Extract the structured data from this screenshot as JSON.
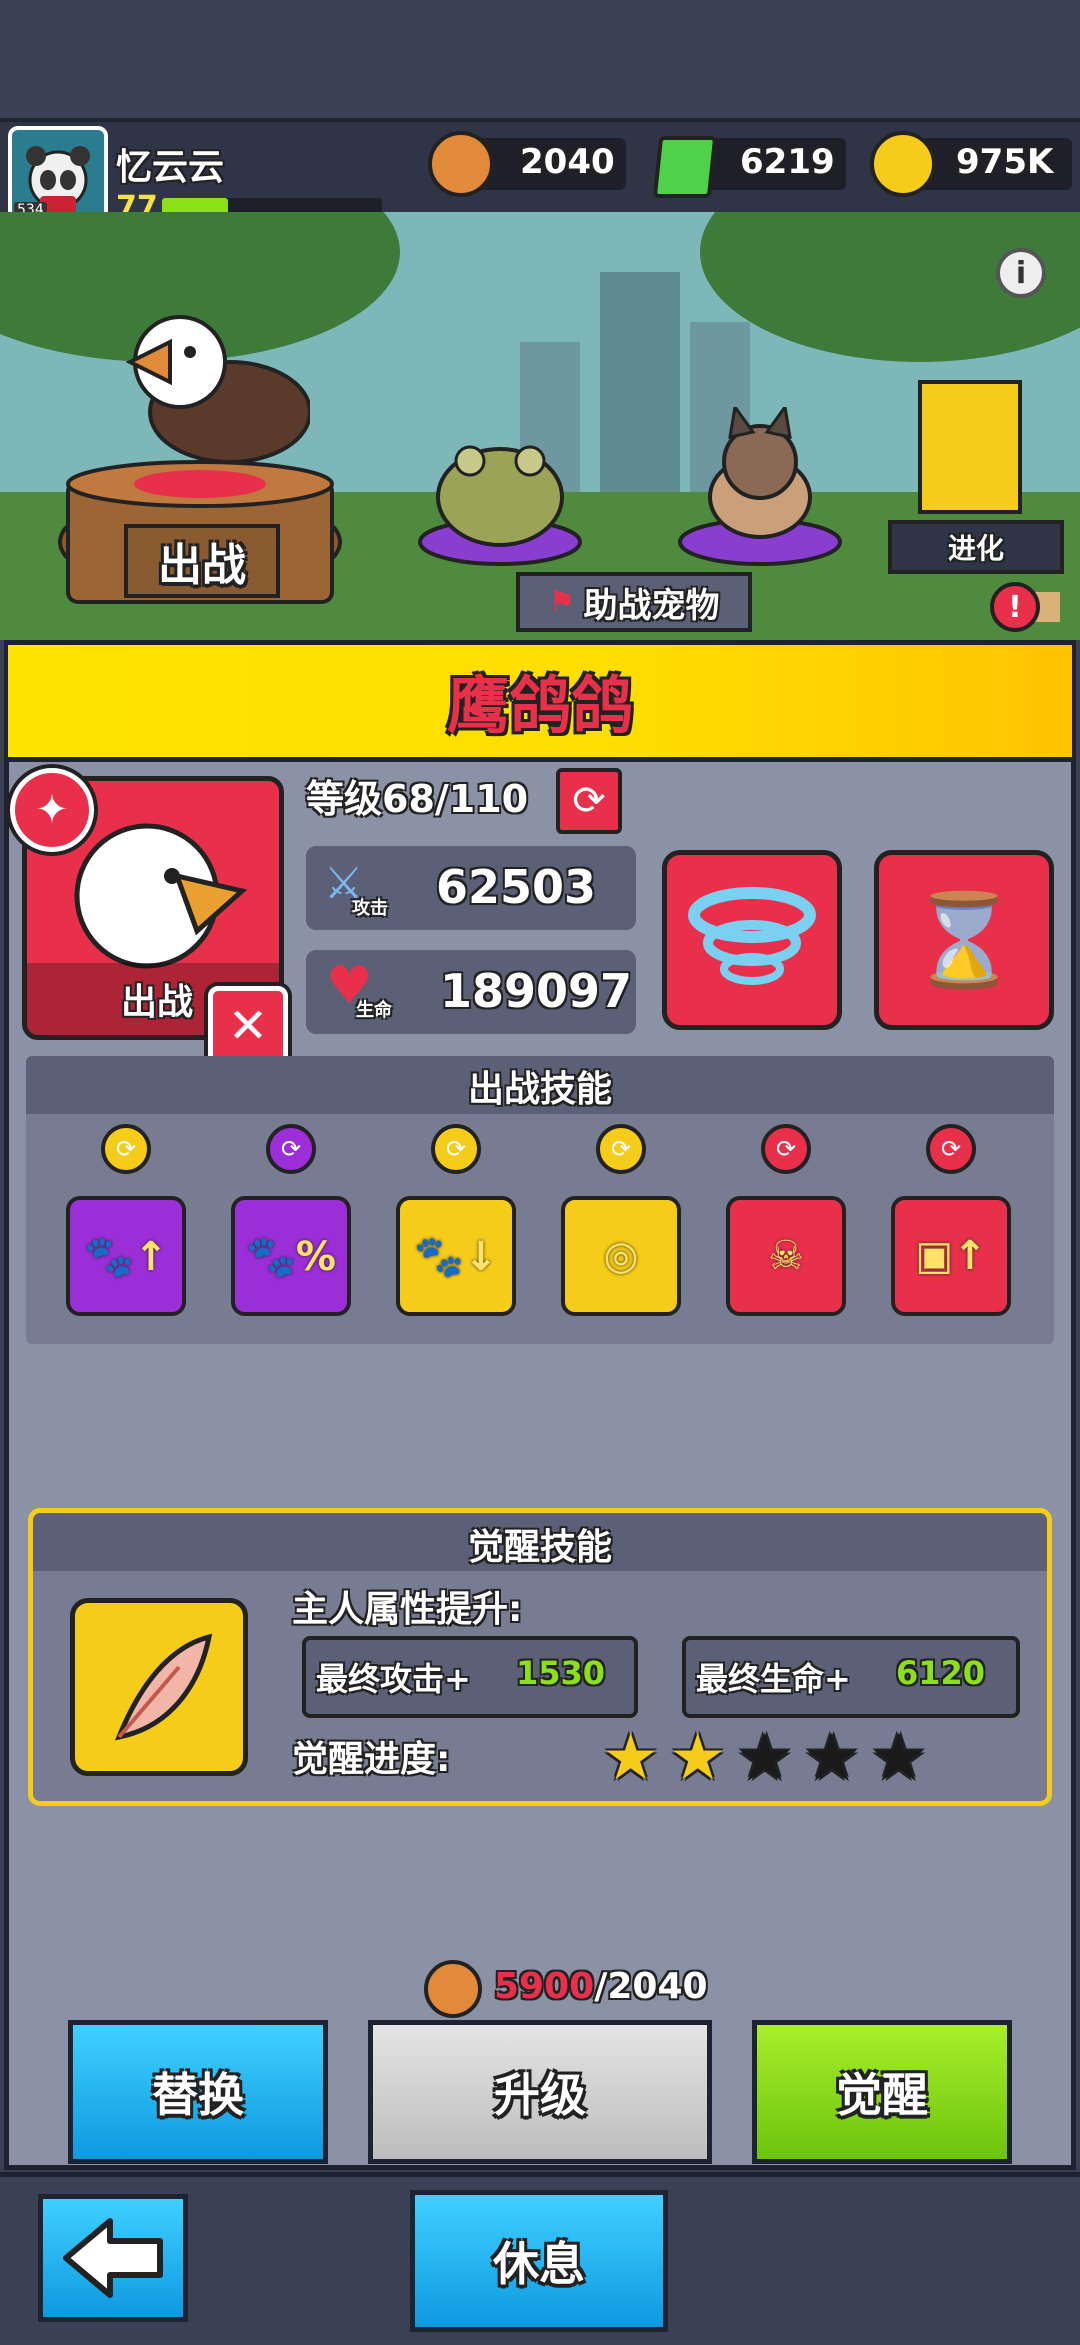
{
  "player": {
    "name": "忆云云",
    "level": "77",
    "avatar_badge": "534",
    "xp_fraction": 0.3
  },
  "resources": {
    "food": "2040",
    "gems": "6219",
    "coins": "975K"
  },
  "scene": {
    "deploy_label": "出战",
    "evolve_label": "进化",
    "support_label": "助战宠物"
  },
  "pet": {
    "name": "鹰鸽鸽",
    "level_text": "等级68/110",
    "attack_label": "攻击",
    "attack_value": "62503",
    "hp_label": "生命",
    "hp_value": "189097",
    "card_label": "出战"
  },
  "battle_skills": {
    "title": "出战技能",
    "skills": [
      {
        "badge_color": "#f5cc1a",
        "tile_color": "#9b2ed6",
        "icon": "paw-up-icon"
      },
      {
        "badge_color": "#9b2ed6",
        "tile_color": "#9b2ed6",
        "icon": "paw-percent-icon"
      },
      {
        "badge_color": "#f5cc1a",
        "tile_color": "#f5cc1a",
        "icon": "paw-down-icon"
      },
      {
        "badge_color": "#f5cc1a",
        "tile_color": "#f5cc1a",
        "icon": "paw-target-icon"
      },
      {
        "badge_color": "#e8304a",
        "tile_color": "#e8304a",
        "icon": "zombie-paw-icon"
      },
      {
        "badge_color": "#e8304a",
        "tile_color": "#e8304a",
        "icon": "chest-up-icon"
      }
    ]
  },
  "awaken": {
    "title": "觉醒技能",
    "subtitle": "主人属性提升:",
    "atk_label": "最终攻击+",
    "atk_value": "1530",
    "hp_label": "最终生命+",
    "hp_value": "6120",
    "progress_label": "觉醒进度:",
    "stars_filled": 2,
    "stars_total": 5
  },
  "cost": {
    "have": "5900",
    "need": "/2040"
  },
  "buttons": {
    "replace": "替换",
    "upgrade": "升级",
    "awaken": "觉醒",
    "rest": "休息"
  },
  "colors": {
    "yellow": "#ffe400",
    "red_card": "#e8304a",
    "green_btn": "#8be01a",
    "blue_btn": "#19b4f0",
    "gray_btn": "#cfcfcf"
  }
}
